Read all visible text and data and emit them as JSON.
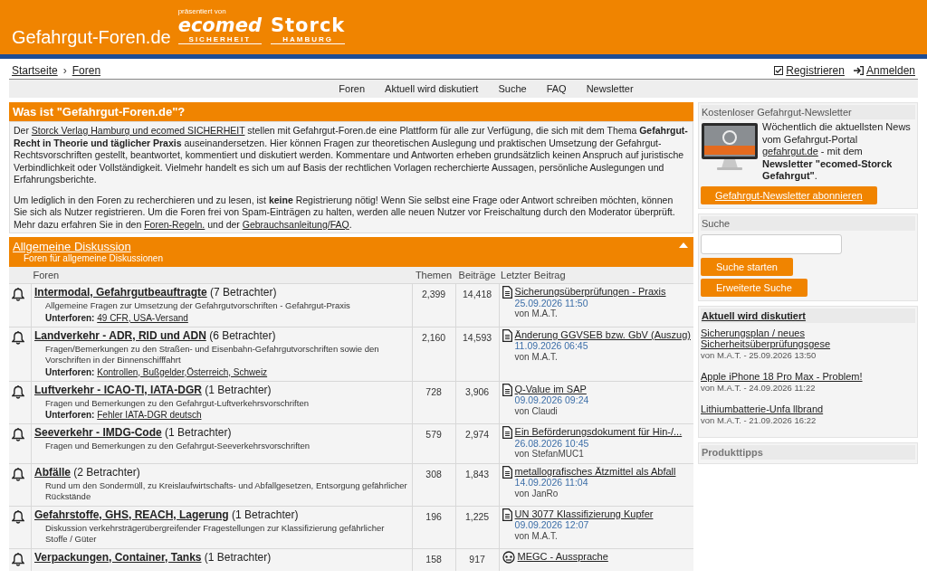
{
  "header": {
    "site_title": "Gefahrgut-Foren.de",
    "presented_by": "präsentiert von",
    "logo_1": {
      "name": "ecomed",
      "sub": "SICHERHEIT"
    },
    "logo_2": {
      "name": "Storck",
      "sub": "HAMBURG"
    }
  },
  "breadcrumb": {
    "separator": "›",
    "items": [
      "Startseite",
      "Foren"
    ]
  },
  "account_links": [
    {
      "kind": "register",
      "label": "Registrieren"
    },
    {
      "kind": "login",
      "label": "Anmelden"
    }
  ],
  "nav": [
    "Foren",
    "Aktuell wird diskutiert",
    "Suche",
    "FAQ",
    "Newsletter"
  ],
  "intro": {
    "title": "Was ist \"Gefahrgut-Foren.de\"?",
    "paragraphs": [
      [
        {
          "kind": "text",
          "text": "Der "
        },
        {
          "kind": "link",
          "text": "Storck Verlag Hamburg und ecomed SICHERHEIT"
        },
        {
          "kind": "text",
          "text": " stellen mit Gefahrgut-Foren.de eine Plattform für alle zur Verfügung, die sich mit dem Thema "
        },
        {
          "kind": "bold",
          "text": "Gefahrgut-Recht in Theorie und täglicher Praxis"
        },
        {
          "kind": "text",
          "text": " auseinandersetzen. Hier können Fragen zur theoretischen Auslegung und praktischen Umsetzung der Gefahrgut-Rechtsvorschriften gestellt, beantwortet, kommentiert und diskutiert werden. Kommentare und Antworten erheben grundsätzlich keinen Anspruch auf juristische Verbindlichkeit oder Vollständigkeit. Vielmehr handelt es sich um auf Basis der rechtlichen Vorlagen recherchierte Aussagen, persönliche Auslegungen und Erfahrungsberichte."
        }
      ],
      [
        {
          "kind": "text",
          "text": "Um lediglich in den Foren zu recherchieren und zu lesen, ist "
        },
        {
          "kind": "bold",
          "text": "keine"
        },
        {
          "kind": "text",
          "text": " Registrierung nötig! Wenn Sie selbst eine Frage oder Antwort schreiben möchten, können Sie sich als Nutzer registrieren. Um die Foren frei von Spam-Einträgen zu halten, werden alle neuen Nutzer vor Freischaltung durch den Moderator überprüft. Mehr dazu erfahren Sie in den "
        },
        {
          "kind": "link",
          "text": "Foren-Regeln."
        },
        {
          "kind": "text",
          "text": " und der "
        },
        {
          "kind": "link",
          "text": "Gebrauchsanleitung/FAQ"
        },
        {
          "kind": "text",
          "text": "."
        }
      ]
    ]
  },
  "category": {
    "title": "Allgemeine Diskussion",
    "subtitle": "Foren für allgemeine Diskussionen",
    "expanded": true,
    "columns": [
      "Foren",
      "Themen",
      "Beiträge",
      "Letzter Beitrag"
    ],
    "subforum_separator": ",",
    "forums": [
      {
        "title": "Intermodal, Gefahrgutbeauftragte",
        "viewers": "(7 Betrachter)",
        "description": "Allgemeine Fragen zur Umsetzung der Gefahrgutvorschriften - Gefahrgut-Praxis",
        "subforums_label": "Unterforen:",
        "subforums": [
          "49 CFR, USA-Versand"
        ],
        "topics": "2,399",
        "posts": "14,418",
        "last_post": {
          "kind": "document",
          "title": "Sicherungsüberprüfungen - Praxis",
          "date": "25.09.2026 11:50",
          "author": "von M.A.T."
        }
      },
      {
        "title": "Landverkehr - ADR, RID und ADN",
        "viewers": "(6 Betrachter)",
        "description": "Fragen/Bemerkungen zu den Straßen- und Eisenbahn-Gefahrgutvorschriften sowie den Vorschriften in der Binnenschifffahrt",
        "subforums_label": "Unterforen:",
        "subforums": [
          "Kontrollen, Bußgelder",
          "Österreich, Schweiz"
        ],
        "topics": "2,160",
        "posts": "14,593",
        "last_post": {
          "kind": "document",
          "title": "Änderung GGVSEB bzw. GbV (Auszug)",
          "date": "11.09.2026 06:45",
          "author": "von M.A.T."
        }
      },
      {
        "title": "Luftverkehr - ICAO-TI, IATA-DGR",
        "viewers": "(1 Betrachter)",
        "description": "Fragen und Bemerkungen zu den Gefahrgut-Luftverkehrsvorschriften",
        "subforums_label": "Unterforen:",
        "subforums": [
          "Fehler IATA-DGR deutsch"
        ],
        "topics": "728",
        "posts": "3,906",
        "last_post": {
          "kind": "document",
          "title": "Q-Value im SAP",
          "date": "09.09.2026 09:24",
          "author": "von Claudi"
        }
      },
      {
        "title": "Seeverkehr - IMDG-Code",
        "viewers": "(1 Betrachter)",
        "description": "Fragen und Bemerkungen zu den Gefahrgut-Seeverkehrsvorschriften",
        "topics": "579",
        "posts": "2,974",
        "last_post": {
          "kind": "document",
          "title": "Ein Beförderungsdokument für Hin-/...",
          "date": "26.08.2026 10:45",
          "author": "von StefanMUC1"
        }
      },
      {
        "title": "Abfälle",
        "viewers": "(2 Betrachter)",
        "description": "Rund um den Sondermüll, zu Kreislaufwirtschafts- und Abfallgesetzen, Entsorgung gefährlicher Rückstände",
        "topics": "308",
        "posts": "1,843",
        "last_post": {
          "kind": "document",
          "title": "metallografisches Ätzmittel als Abfall",
          "date": "14.09.2026 11:04",
          "author": "von JanRo"
        }
      },
      {
        "title": "Gefahrstoffe, GHS, REACH, Lagerung",
        "viewers": "(1 Betrachter)",
        "description": "Diskussion verkehrsträgerübergreifender Fragestellungen zur Klassifizierung gefährlicher Stoffe / Güter",
        "topics": "196",
        "posts": "1,225",
        "last_post": {
          "kind": "document",
          "title": "UN 3077 Klassifizierung Kupfer",
          "date": "09.09.2026 12:07",
          "author": "von M.A.T."
        }
      },
      {
        "title": "Verpackungen, Container, Tanks",
        "viewers": "(1 Betrachter)",
        "topics": "158",
        "posts": "917",
        "last_post": {
          "kind": "discussion",
          "title": "MEGC - Aussprache"
        }
      }
    ]
  },
  "sidebar": {
    "newsletter": {
      "title": "Kostenloser Gefahrgut-Newsletter",
      "text": [
        {
          "kind": "text",
          "text": "Wöchentlich die aktuellsten News vom Gefahrgut-Portal "
        },
        {
          "kind": "link",
          "text": "gefahrgut.de"
        },
        {
          "kind": "text",
          "text": " - mit dem "
        },
        {
          "kind": "bold",
          "text": "Newsletter \"ecomed-Storck Gefahrgut\""
        },
        {
          "kind": "text",
          "text": "."
        }
      ],
      "button": "Gefahrgut-Newsletter abonnieren"
    },
    "search": {
      "title": "Suche",
      "buttons": [
        "Suche starten",
        "Erweiterte Suche"
      ]
    },
    "discussed": {
      "title": "Aktuell wird diskutiert",
      "items": [
        {
          "title": "Sicherungsplan / neues Sicherheitsüberprüfungsgese",
          "meta": "von M.A.T. - 25.09.2026 13:50"
        },
        {
          "title": "Apple iPhone 18 Pro Max - Problem!",
          "meta": "von M.A.T. - 24.09.2026 11:22"
        },
        {
          "title": "Lithiumbatterie-Unfa llbrand",
          "meta": "von M.A.T. - 21.09.2026 16:22"
        }
      ]
    },
    "product_tips": {
      "title": "Produkttipps"
    }
  }
}
